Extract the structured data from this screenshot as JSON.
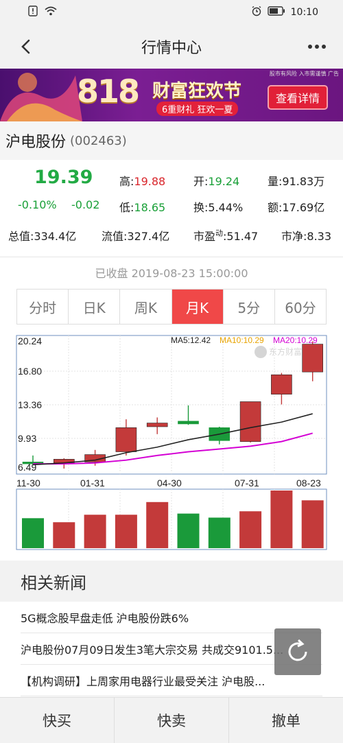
{
  "status_bar": {
    "time": "10:10"
  },
  "nav": {
    "title": "行情中心"
  },
  "banner": {
    "number": "818",
    "title": "财富狂欢节",
    "subtitle": "6重财礼 狂欢一夏",
    "button": "查看详情",
    "note": "股市有风险 入市需谨慎 广告"
  },
  "stock": {
    "name": "沪电股份",
    "code": "(002463)"
  },
  "quote": {
    "price": "19.39",
    "change_pct": "-0.10%",
    "change": "-0.02",
    "high_label": "高:",
    "high": "19.88",
    "low_label": "低:",
    "low": "18.65",
    "open_label": "开:",
    "open": "19.24",
    "turnover": "换:5.44%",
    "volume": "量:91.83万",
    "amount": "额:17.69亿",
    "total_cap": "总值:334.4亿",
    "float_cap": "流值:327.4亿",
    "pe_label": "市盈",
    "pe_sup": "动",
    "pe_value": ":51.47",
    "pb": "市净:8.33"
  },
  "timestamp": "已收盘 2019-08-23 15:00:00",
  "tabs": [
    "分时",
    "日K",
    "周K",
    "月K",
    "5分",
    "60分"
  ],
  "active_tab": 3,
  "colors": {
    "up": "#c33a3a",
    "down": "#1a9a3a",
    "ma5": "#222222",
    "ma10": "#e8a300",
    "ma20": "#d400d4",
    "accent": "#f04848"
  },
  "chart_data": {
    "type": "candlestick",
    "y_ticks": [
      "20.24",
      "16.80",
      "13.36",
      "9.93",
      "6.49"
    ],
    "ylim": [
      6.49,
      20.24
    ],
    "x_ticks": [
      "11-30",
      "01-31",
      "04-30",
      "07-31",
      "08-23"
    ],
    "legend": [
      "MA5:12.42",
      "MA10:10.29",
      "MA20:10.29"
    ],
    "candles": [
      {
        "open": 7.2,
        "close": 7.0,
        "high": 7.9,
        "low": 6.9,
        "volume": 0.52
      },
      {
        "open": 7.1,
        "close": 7.5,
        "high": 7.6,
        "low": 6.3,
        "volume": 0.45
      },
      {
        "open": 7.2,
        "close": 8.0,
        "high": 8.5,
        "low": 6.8,
        "volume": 0.58
      },
      {
        "open": 8.3,
        "close": 10.9,
        "high": 11.8,
        "low": 7.9,
        "volume": 0.58
      },
      {
        "open": 11.0,
        "close": 11.4,
        "high": 12.0,
        "low": 10.2,
        "volume": 0.8
      },
      {
        "open": 11.6,
        "close": 11.3,
        "high": 13.3,
        "low": 11.2,
        "volume": 0.6
      },
      {
        "open": 10.9,
        "close": 9.5,
        "high": 11.0,
        "low": 9.1,
        "volume": 0.53
      },
      {
        "open": 9.4,
        "close": 13.7,
        "high": 13.7,
        "low": 9.3,
        "volume": 0.64
      },
      {
        "open": 14.5,
        "close": 16.6,
        "high": 16.8,
        "low": 13.4,
        "volume": 1.0
      },
      {
        "open": 16.9,
        "close": 19.9,
        "high": 20.2,
        "low": 15.9,
        "volume": 0.83
      }
    ],
    "ma5": [
      6.9,
      7.1,
      7.4,
      8.2,
      8.8,
      9.6,
      10.2,
      10.9,
      11.5,
      12.4
    ],
    "ma20": [
      7.0,
      7.0,
      7.1,
      7.4,
      7.9,
      8.3,
      8.6,
      8.9,
      9.4,
      10.3
    ]
  },
  "news": {
    "title": "相关新闻",
    "items": [
      "5G概念股早盘走低 沪电股份跌6%",
      "沪电股份07月09日发生3笔大宗交易 共成交9101.5...",
      "【机构调研】上周家用电器行业最受关注 沪电股..."
    ]
  },
  "bottom": {
    "buy": "快买",
    "sell": "快卖",
    "cancel": "撤单"
  }
}
